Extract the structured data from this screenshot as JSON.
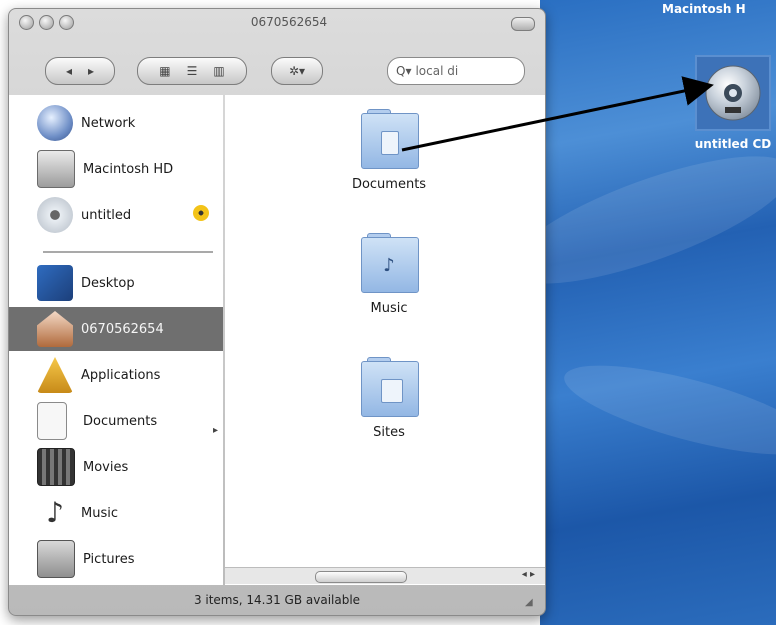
{
  "desktop": {
    "menubar_fragment": "Macintosh H",
    "cd_icon_label": "untitled CD",
    "cd_icon": "cd-disc-icon"
  },
  "window": {
    "title": "0670562654",
    "toolbar": {
      "back_label": "◂",
      "forward_label": "▸",
      "view_icons": [
        "icon-view-icon",
        "list-view-icon",
        "column-view-icon"
      ],
      "action_label": "✲▾",
      "search_placeholder": "local di"
    },
    "sidebar": {
      "devices": [
        {
          "label": "Network",
          "icon": "network-globe-icon"
        },
        {
          "label": "Macintosh HD",
          "icon": "hard-drive-icon"
        },
        {
          "label": "untitled",
          "icon": "cd-disc-icon",
          "eject": "burn-icon"
        }
      ],
      "places": [
        {
          "label": "Desktop",
          "icon": "desktop-icon"
        },
        {
          "label": "0670562654",
          "icon": "home-icon",
          "selected": true
        },
        {
          "label": "Applications",
          "icon": "applications-icon"
        },
        {
          "label": "Documents",
          "icon": "documents-icon"
        },
        {
          "label": "Movies",
          "icon": "movies-icon"
        },
        {
          "label": "Music",
          "icon": "music-icon"
        },
        {
          "label": "Pictures",
          "icon": "pictures-icon"
        }
      ]
    },
    "content": {
      "folders": [
        {
          "name": "Documents",
          "icon": "documents-folder-icon"
        },
        {
          "name": "Music",
          "icon": "music-folder-icon"
        },
        {
          "name": "Sites",
          "icon": "sites-folder-icon"
        }
      ]
    },
    "status": "3 items, 14.31 GB available"
  },
  "colors": {
    "selection": "#6f6f6f",
    "desktop_blue": "#2a6fc2",
    "arrow": "#000000"
  }
}
